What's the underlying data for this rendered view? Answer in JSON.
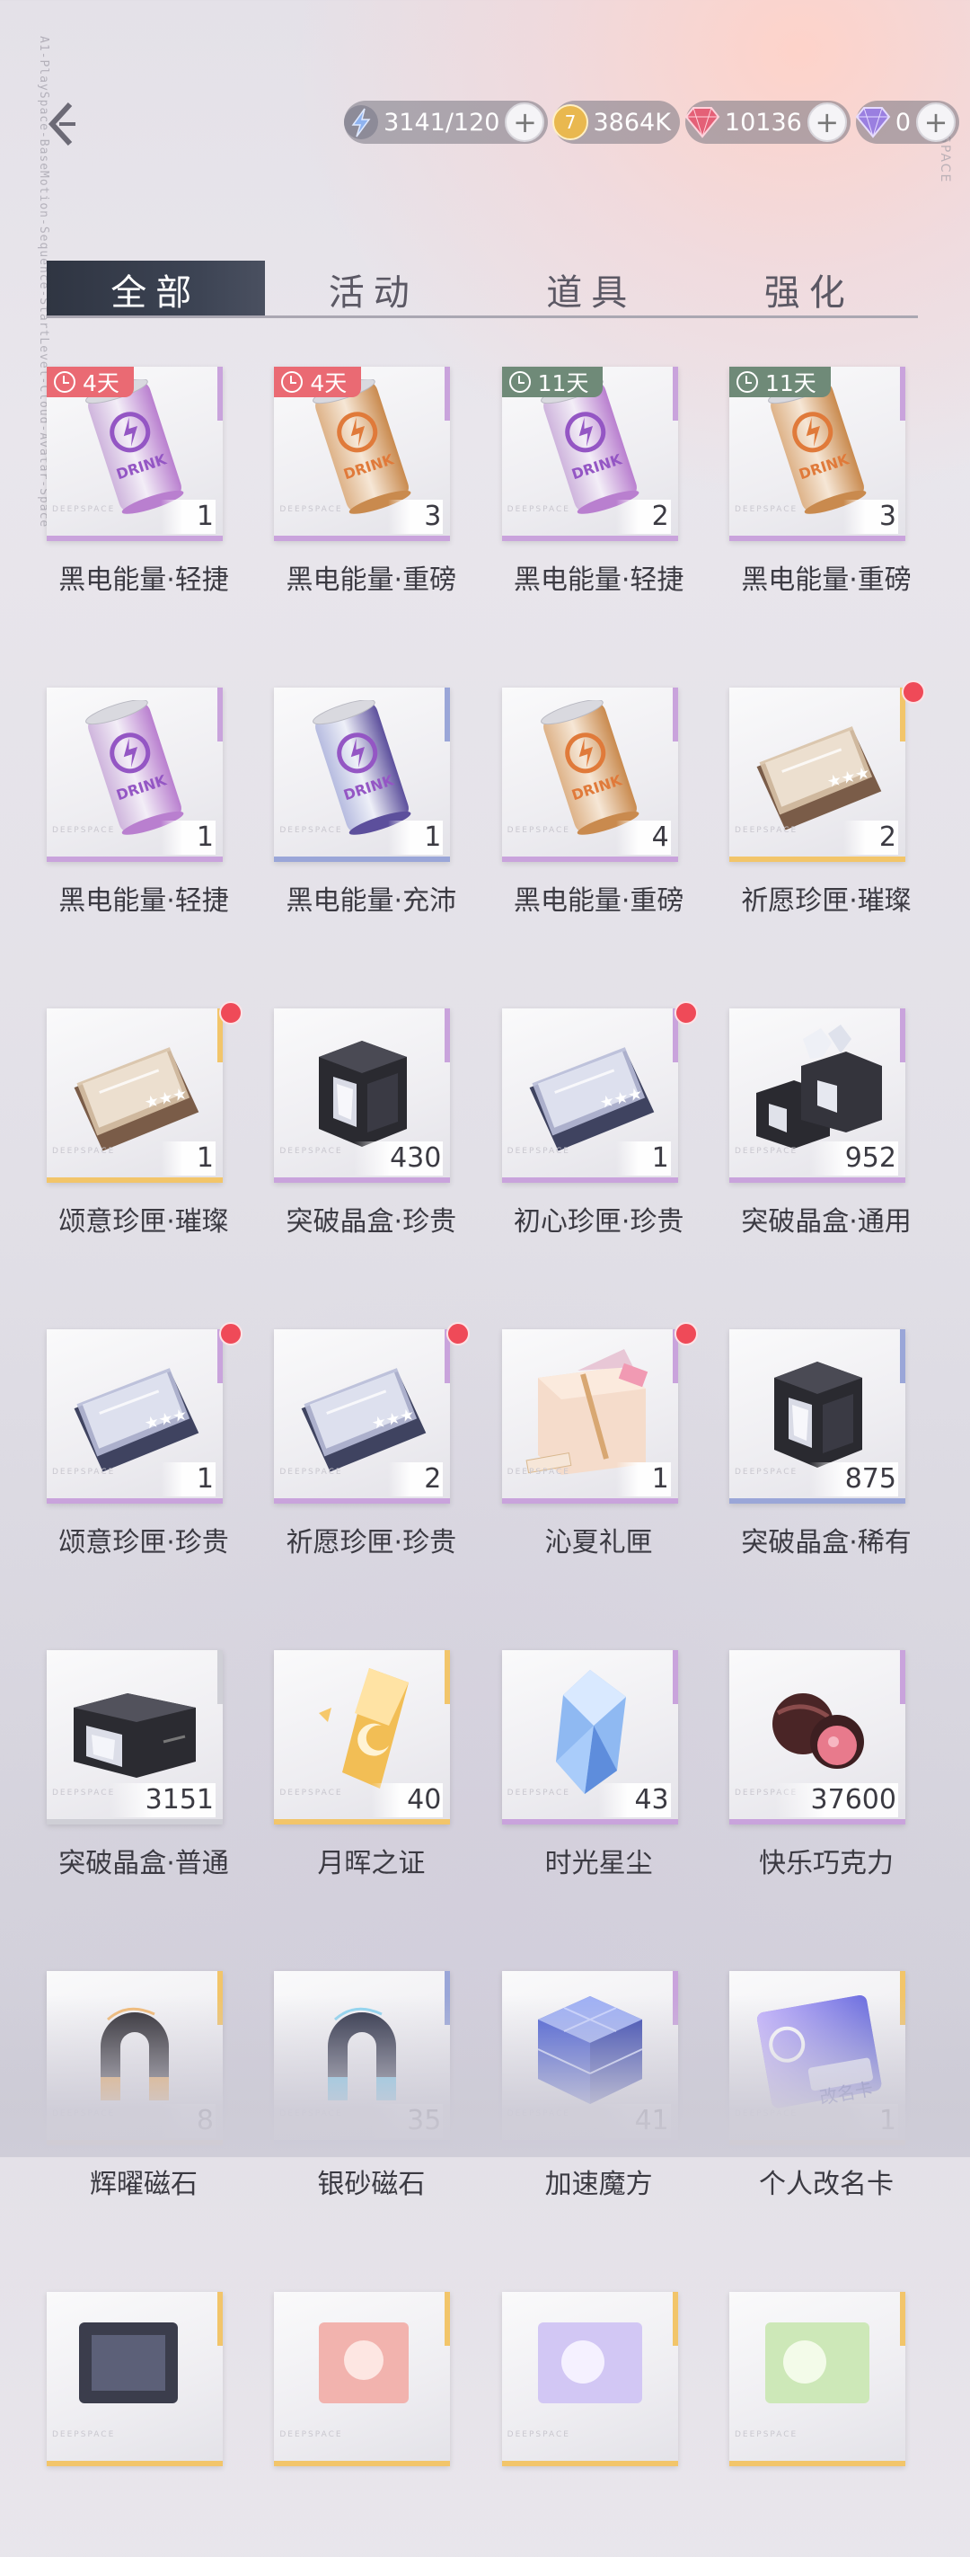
{
  "side_text": "A1-PlaySpace-BaseMotion-Sequence-StartLevel-Cloud-Avatar-Space",
  "side_text_right": "SPACE",
  "header": {
    "currencies": [
      {
        "icon": "stamina-bolt-icon",
        "value": "3141/120",
        "color": "#6f8fd8"
      },
      {
        "icon": "gold-coin-icon",
        "value": "3864K",
        "color": "#e6b34a"
      },
      {
        "icon": "red-diamond-icon",
        "value": "10136",
        "color": "#d6526a"
      },
      {
        "icon": "purple-diamond-icon",
        "value": "0",
        "color": "#8a6fd0"
      }
    ],
    "plus_label": "+"
  },
  "tabs": [
    {
      "label": "全部",
      "active": true
    },
    {
      "label": "活动",
      "active": false
    },
    {
      "label": "道具",
      "active": false
    },
    {
      "label": "强化",
      "active": false
    }
  ],
  "brand_label": "DEEPSPACE",
  "items": [
    {
      "name": "黑电能量·轻捷",
      "count": "1",
      "art": "can-purple",
      "rarity": "#c9a3dc",
      "timer": "4天",
      "timer_color": "#ea6a73"
    },
    {
      "name": "黑电能量·重磅",
      "count": "3",
      "art": "can-gold",
      "rarity": "#c9a3dc",
      "timer": "4天",
      "timer_color": "#ea6a73"
    },
    {
      "name": "黑电能量·轻捷",
      "count": "2",
      "art": "can-purple",
      "rarity": "#c9a3dc",
      "timer": "11天",
      "timer_color": "#6f8a78"
    },
    {
      "name": "黑电能量·重磅",
      "count": "3",
      "art": "can-gold",
      "rarity": "#c9a3dc",
      "timer": "11天",
      "timer_color": "#6f8a78"
    },
    {
      "name": "黑电能量·轻捷",
      "count": "1",
      "art": "can-purple",
      "rarity": "#c9a3dc"
    },
    {
      "name": "黑电能量·充沛",
      "count": "1",
      "art": "can-blue",
      "rarity": "#9aa6d8"
    },
    {
      "name": "黑电能量·重磅",
      "count": "4",
      "art": "can-gold",
      "rarity": "#c9a3dc"
    },
    {
      "name": "祈愿珍匣·璀璨",
      "count": "2",
      "art": "box-gold",
      "rarity": "#f2c56a",
      "dot": true
    },
    {
      "name": "颂意珍匣·璀璨",
      "count": "1",
      "art": "box-gold",
      "rarity": "#f2c56a",
      "dot": true
    },
    {
      "name": "突破晶盒·珍贵",
      "count": "430",
      "art": "crate-dark",
      "rarity": "#c9a3dc"
    },
    {
      "name": "初心珍匣·珍贵",
      "count": "1",
      "art": "box-silver",
      "rarity": "#c9a3dc",
      "dot": true
    },
    {
      "name": "突破晶盒·通用",
      "count": "952",
      "art": "crate-pile",
      "rarity": "#c9a3dc"
    },
    {
      "name": "颂意珍匣·珍贵",
      "count": "1",
      "art": "box-silver",
      "rarity": "#c9a3dc",
      "dot": true
    },
    {
      "name": "祈愿珍匣·珍贵",
      "count": "2",
      "art": "box-silver",
      "rarity": "#c9a3dc",
      "dot": true
    },
    {
      "name": "沁夏礼匣",
      "count": "1",
      "art": "gift-pink",
      "rarity": "#c9a3dc",
      "dot": true
    },
    {
      "name": "突破晶盒·稀有",
      "count": "875",
      "art": "crate-dark",
      "rarity": "#9aa6d8"
    },
    {
      "name": "突破晶盒·普通",
      "count": "3151",
      "art": "crate-flat",
      "rarity": "#cfcfd6"
    },
    {
      "name": "月晖之证",
      "count": "40",
      "art": "moon-crystal",
      "rarity": "#f2c56a"
    },
    {
      "name": "时光星尘",
      "count": "43",
      "art": "blue-crystal",
      "rarity": "#c9a3dc"
    },
    {
      "name": "快乐巧克力",
      "count": "37600",
      "art": "chocolate",
      "rarity": "#c9a3dc"
    },
    {
      "name": "辉曜磁石",
      "count": "8",
      "art": "magnet-gold",
      "rarity": "#f2c56a"
    },
    {
      "name": "银砂磁石",
      "count": "35",
      "art": "magnet-blue",
      "rarity": "#9aa6d8"
    },
    {
      "name": "加速魔方",
      "count": "41",
      "art": "cube-blue",
      "rarity": "#c9a3dc"
    },
    {
      "name": "个人改名卡",
      "count": "1",
      "art": "rename-card",
      "rarity": "#f2c56a",
      "card_text": "改名卡"
    },
    {
      "name": "",
      "count": "",
      "art": "partial-dark",
      "rarity": "#f2c56a"
    },
    {
      "name": "",
      "count": "",
      "art": "partial-red",
      "rarity": "#f2c56a"
    },
    {
      "name": "",
      "count": "",
      "art": "partial-purple",
      "rarity": "#f2c56a"
    },
    {
      "name": "",
      "count": "",
      "art": "partial-green",
      "rarity": "#f2c56a"
    }
  ]
}
